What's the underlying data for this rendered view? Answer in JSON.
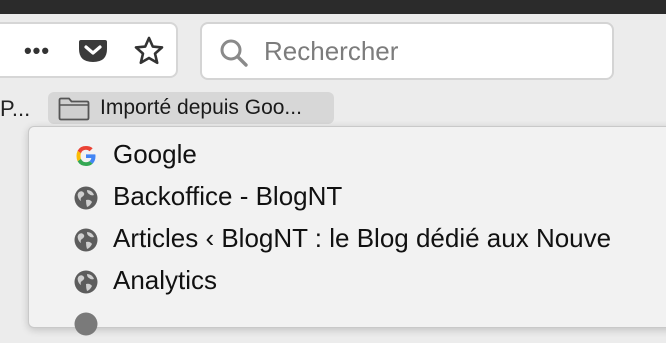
{
  "toolbar": {
    "more_label": "•••"
  },
  "search": {
    "placeholder": "Rechercher"
  },
  "bookmarks_bar": {
    "prev_label": "P...",
    "folder_label": "Importé depuis Goo..."
  },
  "menu": {
    "items": [
      {
        "label": "Google",
        "icon": "google-icon"
      },
      {
        "label": "Backoffice - BlogNT",
        "icon": "globe-icon"
      },
      {
        "label": "Articles ‹ BlogNT : le Blog dédié aux Nouve",
        "icon": "globe-icon"
      },
      {
        "label": "Analytics",
        "icon": "globe-icon"
      }
    ]
  },
  "colors": {
    "topbar": "#2b2b2b",
    "toolbar_bg": "#ececec",
    "folder_bg": "#d7d7d7",
    "menu_bg": "#f2f2f2"
  }
}
